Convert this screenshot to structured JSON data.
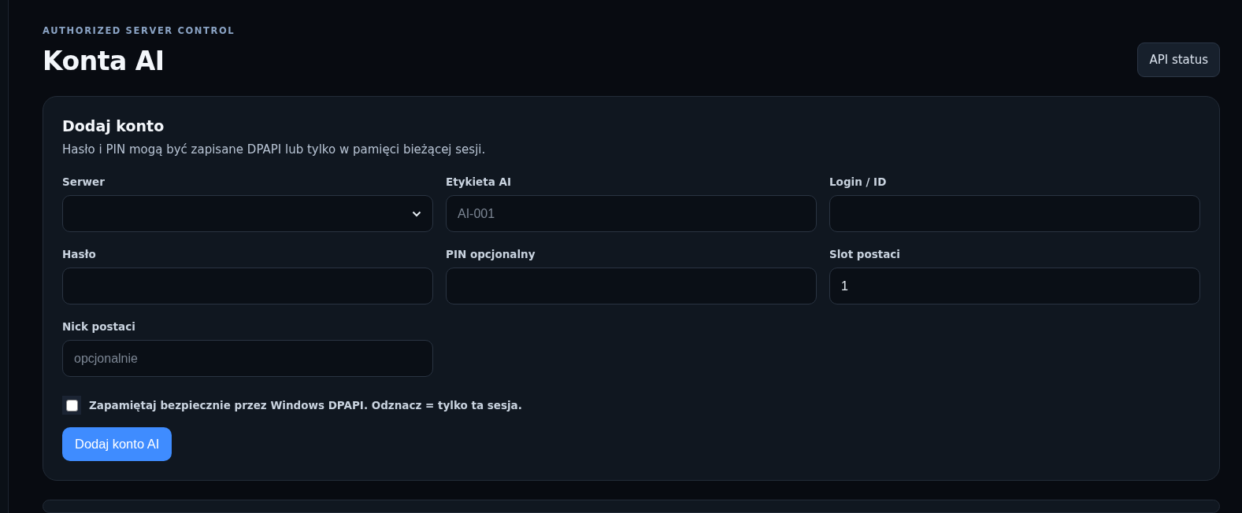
{
  "header": {
    "eyebrow": "AUTHORIZED SERVER CONTROL",
    "title": "Konta AI",
    "action_button": "API status"
  },
  "add_account": {
    "title": "Dodaj konto",
    "description": "Hasło i PIN mogą być zapisane DPAPI lub tylko w pamięci bieżącej sesji.",
    "fields": [
      {
        "label": "Serwer",
        "kind": "select"
      },
      {
        "label": "Etykieta AI",
        "kind": "input",
        "placeholder": "AI-001"
      },
      {
        "label": "Login / ID",
        "kind": "input"
      },
      {
        "label": "Hasło",
        "kind": "input"
      },
      {
        "label": "PIN opcjonalny",
        "kind": "input"
      },
      {
        "label": "Slot postaci",
        "kind": "input",
        "value": "1"
      },
      {
        "label": "Nick postaci",
        "kind": "input",
        "placeholder": "opcjonalnie"
      }
    ],
    "remember": {
      "label": "Zapamiętaj bezpiecznie przez Windows DPAPI. Odznacz = tylko ta sesja.",
      "checked": false
    },
    "submit_button": "Dodaj konto AI"
  }
}
